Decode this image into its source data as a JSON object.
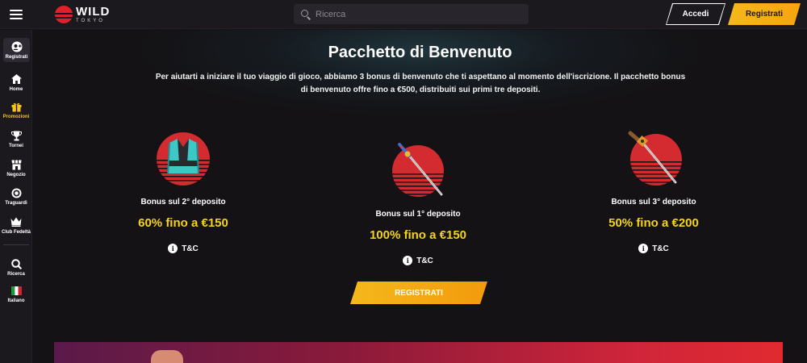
{
  "header": {
    "logo_wild": "WILD",
    "logo_tokyo": "TOKYO",
    "search_placeholder": "Ricerca",
    "login_label": "Accedi",
    "register_label": "Registrati"
  },
  "sidebar": {
    "items": [
      {
        "label": "Registrati",
        "icon": "user-add-icon"
      },
      {
        "label": "Home",
        "icon": "home-icon"
      },
      {
        "label": "Promozioni",
        "icon": "gift-icon"
      },
      {
        "label": "Tornei",
        "icon": "trophy-icon"
      },
      {
        "label": "Negozio",
        "icon": "shop-icon"
      },
      {
        "label": "Traguardi",
        "icon": "target-icon"
      },
      {
        "label": "Club Fedeltà",
        "icon": "crown-icon"
      },
      {
        "label": "Ricerca",
        "icon": "search-icon"
      },
      {
        "label": "Italiano",
        "icon": "italy-flag-icon"
      }
    ]
  },
  "main": {
    "title": "Pacchetto di Benvenuto",
    "subtitle": "Per aiutarti a iniziare il tuo viaggio di gioco, abbiamo 3 bonus di benvenuto che ti aspettano al momento dell'iscrizione. Il pacchetto bonus di benvenuto offre fino a €500, distribuiti sui primi tre depositi.",
    "cards": [
      {
        "title": "Bonus sul 2° deposito",
        "value": "60% fino a €150",
        "tc": "T&C",
        "art": "vest-icon"
      },
      {
        "title": "Bonus sul 1° deposito",
        "value": "100% fino a €150",
        "tc": "T&C",
        "art": "katana-icon"
      },
      {
        "title": "Bonus sul 3° deposito",
        "value": "50% fino a €200",
        "tc": "T&C",
        "art": "sword-icon"
      }
    ],
    "cta_label": "REGISTRATI"
  },
  "colors": {
    "accent_yellow": "#f5c518",
    "brand_red": "#e2202b",
    "background": "#141215"
  }
}
